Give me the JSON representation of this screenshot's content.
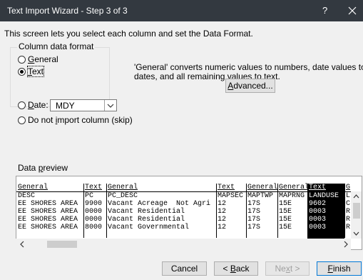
{
  "window": {
    "title": "Text Import Wizard - Step 3 of 3",
    "help": "?"
  },
  "intro": "This screen lets you select each column and set the Data Format.",
  "column_format": {
    "group_label": "Column data format",
    "options": [
      "General",
      "Text",
      "Date:",
      "Do not import column (skip)"
    ],
    "selected": "Text",
    "date_value": "MDY"
  },
  "info_text": "'General' converts numeric values to numbers, date values to dates, and all remaining values to text.",
  "advanced_label": "Advanced...",
  "preview": {
    "label": "Data preview",
    "headers": [
      "General",
      "Text",
      "General",
      "Text",
      "General",
      "General",
      "Text",
      "G"
    ],
    "rows": [
      [
        "DESC",
        "PC",
        "PC_DESC",
        "MAPSEC",
        "MAPTWP",
        "MAPRNG",
        "LANDUSE",
        "L"
      ],
      [
        "EE SHORES AREA",
        "9900",
        "Vacant Acreage  Not Agri",
        "12",
        "17S",
        "15E",
        "9602",
        "C"
      ],
      [
        "EE SHORES AREA",
        "0000",
        "Vacant Residential",
        "12",
        "17S",
        "15E",
        "0003",
        "R"
      ],
      [
        "EE SHORES AREA",
        "0000",
        "Vacant Residential",
        "12",
        "17S",
        "15E",
        "0003",
        "R"
      ],
      [
        "EE SHORES AREA",
        "8000",
        "Vacant Governmental",
        "12",
        "17S",
        "15E",
        "0003",
        "R"
      ]
    ]
  },
  "buttons": {
    "cancel": "Cancel",
    "back": "< Back",
    "next": "Next >",
    "finish": "Finish"
  },
  "colors": {
    "titlebar": "#333940",
    "selected_column": "#000000",
    "focus": "#0078d7"
  }
}
